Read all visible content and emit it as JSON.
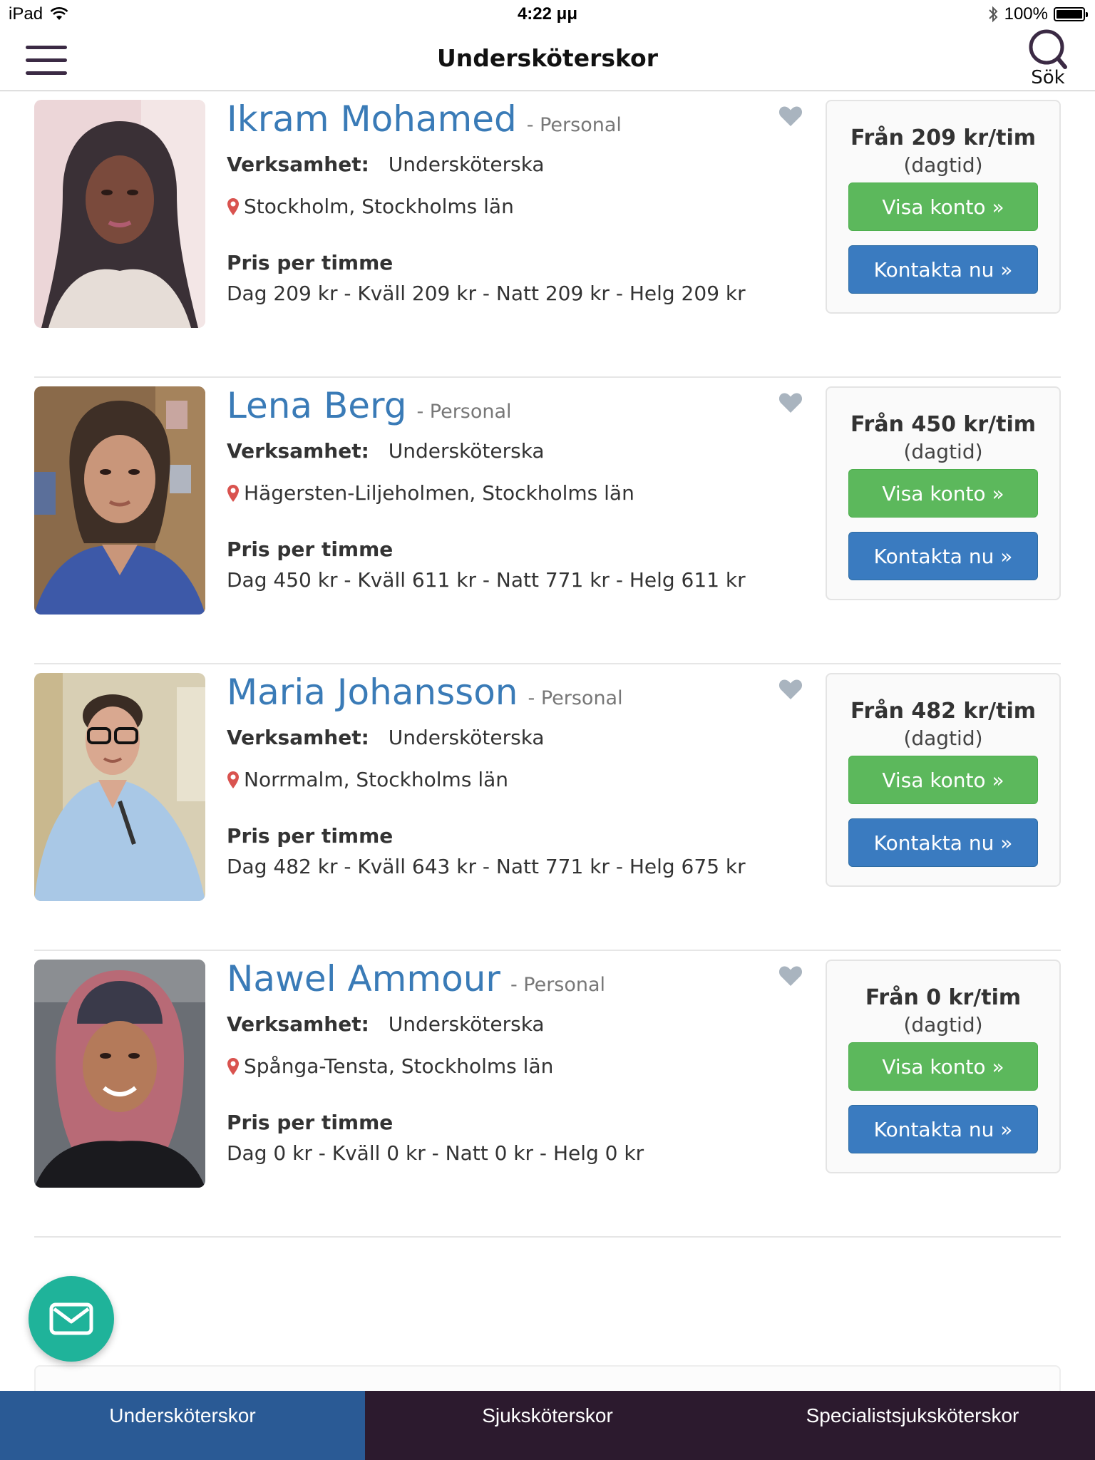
{
  "status_bar": {
    "device": "iPad",
    "time": "4:22 μμ",
    "battery": "100%"
  },
  "header": {
    "title": "Undersköterskor",
    "search_label": "Sök"
  },
  "colors": {
    "name_blue": "#3a7bb7",
    "button_green": "#5cb85c",
    "button_blue": "#3a7bc0",
    "fab_teal": "#1fb39a",
    "tabbar_bg": "#2c1a2e",
    "tab_active_bg": "#2a5a95",
    "pin_red": "#d9534f"
  },
  "listing": [
    {
      "name": "Ikram Mohamed",
      "tag": "- Personal",
      "verk_label": "Verksamhet:",
      "verk_value": "Undersköterska",
      "location": "Stockholm, Stockholms län",
      "pris_title": "Pris per timme",
      "pris_line": "Dag 209 kr - Kväll 209 kr - Natt 209 kr - Helg 209 kr",
      "from": "Från 209 kr/tim",
      "from_sub": "(dagtid)",
      "btn_visa": "Visa konto »",
      "btn_kontakta": "Kontakta nu »"
    },
    {
      "name": "Lena Berg",
      "tag": "- Personal",
      "verk_label": "Verksamhet:",
      "verk_value": "Undersköterska",
      "location": "Hägersten-Liljeholmen, Stockholms län",
      "pris_title": "Pris per timme",
      "pris_line": "Dag 450 kr - Kväll 611 kr - Natt 771 kr - Helg 611 kr",
      "from": "Från 450 kr/tim",
      "from_sub": "(dagtid)",
      "btn_visa": "Visa konto »",
      "btn_kontakta": "Kontakta nu »"
    },
    {
      "name": "Maria Johansson",
      "tag": "- Personal",
      "verk_label": "Verksamhet:",
      "verk_value": "Undersköterska",
      "location": "Norrmalm, Stockholms län",
      "pris_title": "Pris per timme",
      "pris_line": "Dag 482 kr - Kväll 643 kr - Natt 771 kr - Helg 675 kr",
      "from": "Från 482 kr/tim",
      "from_sub": "(dagtid)",
      "btn_visa": "Visa konto »",
      "btn_kontakta": "Kontakta nu »"
    },
    {
      "name": "Nawel Ammour",
      "tag": "- Personal",
      "verk_label": "Verksamhet:",
      "verk_value": "Undersköterska",
      "location": "Spånga-Tensta, Stockholms län",
      "pris_title": "Pris per timme",
      "pris_line": "Dag 0 kr - Kväll 0 kr - Natt 0 kr - Helg 0 kr",
      "from": "Från 0 kr/tim",
      "from_sub": "(dagtid)",
      "btn_visa": "Visa konto »",
      "btn_kontakta": "Kontakta nu »"
    }
  ],
  "tabs": [
    {
      "label": "Undersköterskor",
      "active": true
    },
    {
      "label": "Sjuksköterskor",
      "active": false
    },
    {
      "label": "Specialistsjuksköterskor",
      "active": false
    }
  ],
  "icons": {
    "menu": "hamburger-menu-icon",
    "search": "search-icon",
    "heart": "heart-icon",
    "pin": "map-pin-icon",
    "mail": "mail-icon",
    "wifi": "wifi-icon",
    "bluetooth": "bluetooth-icon",
    "battery": "battery-icon"
  }
}
